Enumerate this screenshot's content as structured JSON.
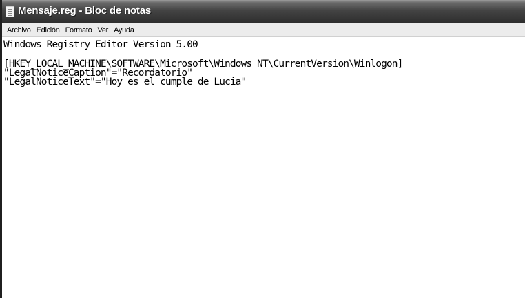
{
  "window": {
    "title": "Mensaje.reg - Bloc de notas",
    "icon": "notepad-icon"
  },
  "menu": {
    "items": [
      {
        "label": "Archivo"
      },
      {
        "label": "Edición"
      },
      {
        "label": "Formato"
      },
      {
        "label": "Ver"
      },
      {
        "label": "Ayuda"
      }
    ]
  },
  "editor": {
    "lines": [
      "Windows Registry Editor Version 5.00",
      "",
      "[HKEY_LOCAL_MACHINE\\SOFTWARE\\Microsoft\\Windows NT\\CurrentVersion\\Winlogon]",
      "\"LegalNoticeCaption\"=\"Recordatorio\"",
      "\"LegalNoticeText\"=\"Hoy es el cumple de Lucia\""
    ]
  },
  "colors": {
    "titlebar": "#3a3a3a",
    "menubar": "#ececec",
    "editor_background": "#ffffff"
  }
}
